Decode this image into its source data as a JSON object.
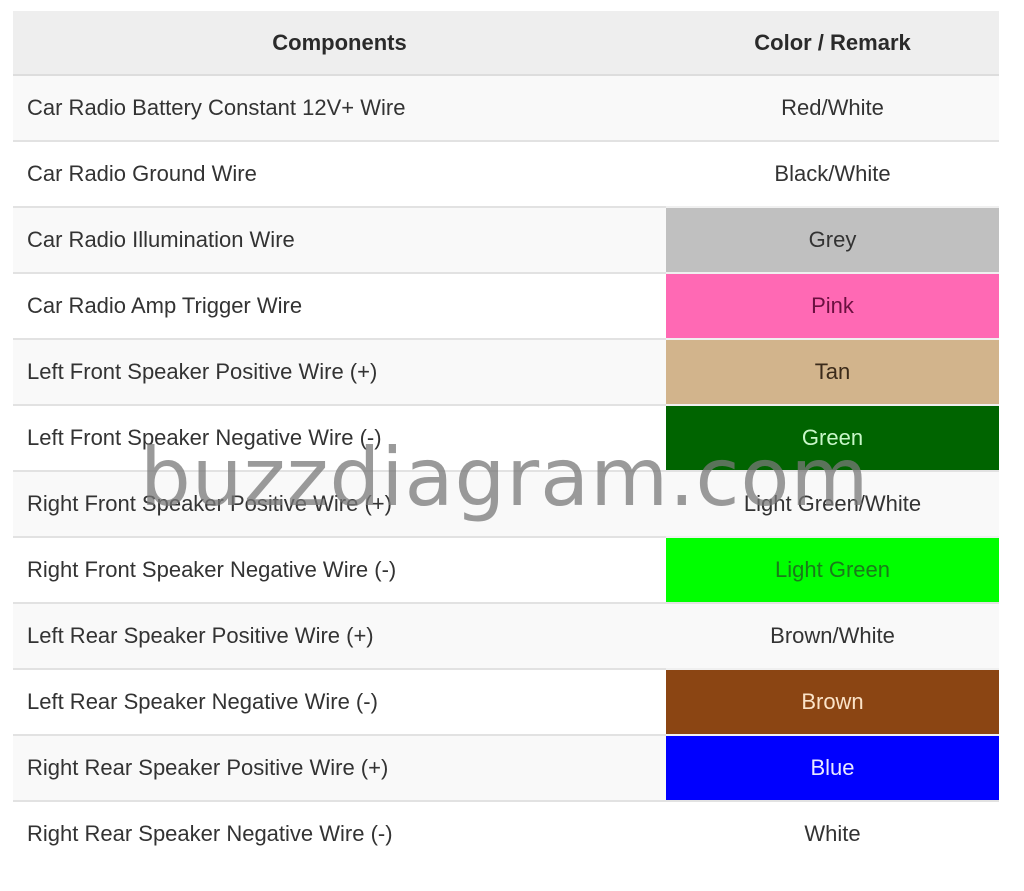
{
  "table": {
    "headers": {
      "components": "Components",
      "color_remark": "Color / Remark"
    },
    "rows": [
      {
        "component": "Car Radio Battery Constant 12V+ Wire",
        "color": "Red/White",
        "bg": "",
        "fg": ""
      },
      {
        "component": "Car Radio Ground Wire",
        "color": "Black/White",
        "bg": "",
        "fg": ""
      },
      {
        "component": "Car Radio Illumination Wire",
        "color": "Grey",
        "bg": "#c0c0c0",
        "fg": "#333333"
      },
      {
        "component": "Car Radio Amp Trigger Wire",
        "color": "Pink",
        "bg": "#ff69b4",
        "fg": "#6b1040"
      },
      {
        "component": "Left Front Speaker Positive Wire (+)",
        "color": "Tan",
        "bg": "#d2b48c",
        "fg": "#3a2a1a"
      },
      {
        "component": "Left Front Speaker Negative Wire (-)",
        "color": "Green",
        "bg": "#006400",
        "fg": "#c8f7c8"
      },
      {
        "component": "Right Front Speaker Positive Wire (+)",
        "color": "Light Green/White",
        "bg": "",
        "fg": ""
      },
      {
        "component": "Right Front Speaker Negative Wire (-)",
        "color": "Light Green",
        "bg": "#00ff00",
        "fg": "#1a7a1a"
      },
      {
        "component": "Left Rear Speaker Positive Wire (+)",
        "color": "Brown/White",
        "bg": "",
        "fg": ""
      },
      {
        "component": "Left Rear Speaker Negative Wire (-)",
        "color": "Brown",
        "bg": "#8b4513",
        "fg": "#fbe3c8"
      },
      {
        "component": "Right Rear Speaker Positive Wire (+)",
        "color": "Blue",
        "bg": "#0000ff",
        "fg": "#e8e8ff"
      },
      {
        "component": "Right Rear Speaker Negative Wire (-)",
        "color": "White",
        "bg": "",
        "fg": ""
      }
    ]
  },
  "watermark": "buzzdiagram.com"
}
